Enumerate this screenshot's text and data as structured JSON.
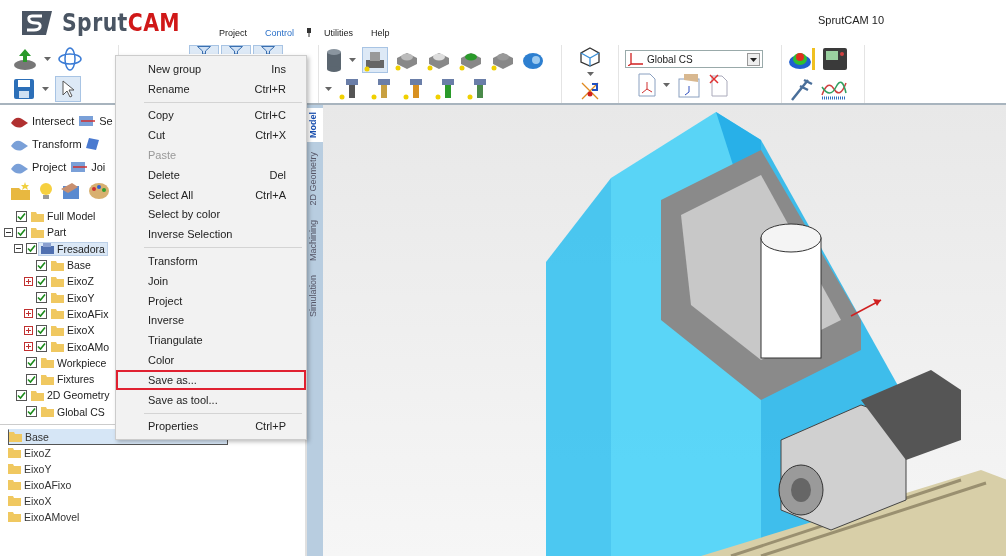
{
  "app": {
    "logo_left": "Sprut",
    "logo_right": "CAM",
    "title": "SprutCAM 10"
  },
  "menu_bar": [
    {
      "label": "Project",
      "selected": false
    },
    {
      "label": "Control",
      "selected": true
    },
    {
      "label": "Utilities",
      "selected": false
    },
    {
      "label": "Help",
      "selected": false
    }
  ],
  "toolbar": {
    "coordinate_system": "Global CS"
  },
  "tool_rows": [
    [
      {
        "label": "Intersect"
      },
      {
        "label": "Se"
      }
    ],
    [
      {
        "label": "Transform"
      }
    ],
    [
      {
        "label": "Project"
      },
      {
        "label": "Joi"
      }
    ]
  ],
  "tree": [
    {
      "label": "Full Model",
      "kind": "folder",
      "expandable": false,
      "checked": true,
      "selected": false
    },
    {
      "label": "Part",
      "kind": "folder",
      "expandable": true,
      "expanded": true,
      "checked": true,
      "selected": false,
      "children": [
        {
          "label": "Fresadora",
          "kind": "model",
          "expandable": true,
          "expanded": true,
          "checked": true,
          "selected": true,
          "children": [
            {
              "label": "Base",
              "kind": "folder",
              "expandable": false,
              "checked": true,
              "selected": false
            },
            {
              "label": "EixoZ",
              "kind": "folder",
              "expandable": true,
              "expanded": false,
              "checked": true,
              "selected": false
            },
            {
              "label": "EixoY",
              "kind": "folder",
              "expandable": false,
              "checked": true,
              "selected": false
            },
            {
              "label": "EixoAFix",
              "kind": "folder",
              "expandable": true,
              "expanded": false,
              "checked": true,
              "selected": false
            },
            {
              "label": "EixoX",
              "kind": "folder",
              "expandable": true,
              "expanded": false,
              "checked": true,
              "selected": false
            },
            {
              "label": "EixoAMo",
              "kind": "folder",
              "expandable": true,
              "expanded": false,
              "checked": true,
              "selected": false
            }
          ]
        },
        {
          "label": "Workpiece",
          "kind": "folder",
          "expandable": false,
          "checked": true,
          "selected": false
        },
        {
          "label": "Fixtures",
          "kind": "folder",
          "expandable": false,
          "checked": true,
          "selected": false
        }
      ]
    },
    {
      "label": "2D Geometry",
      "kind": "folder",
      "expandable": false,
      "checked": true,
      "selected": false,
      "children": [
        {
          "label": "Global CS",
          "kind": "folder",
          "expandable": false,
          "checked": true,
          "selected": false
        }
      ]
    }
  ],
  "parts_list": [
    {
      "label": "Base",
      "selected": true
    },
    {
      "label": "EixoZ",
      "selected": false
    },
    {
      "label": "EixoY",
      "selected": false
    },
    {
      "label": "EixoAFixo",
      "selected": false
    },
    {
      "label": "EixoX",
      "selected": false
    },
    {
      "label": "EixoAMovel",
      "selected": false
    }
  ],
  "side_tabs": [
    {
      "label": "Model",
      "selected": true
    },
    {
      "label": "2D Geometry",
      "selected": false
    },
    {
      "label": "Machining",
      "selected": false
    },
    {
      "label": "Simulation",
      "selected": false
    }
  ],
  "context_menu": [
    [
      {
        "label": "New group",
        "shortcut": "Ins",
        "disabled": false,
        "highlighted": false
      },
      {
        "label": "Rename",
        "shortcut": "Ctrl+R",
        "disabled": false,
        "highlighted": false
      }
    ],
    [
      {
        "label": "Copy",
        "shortcut": "Ctrl+C",
        "disabled": false,
        "highlighted": false
      },
      {
        "label": "Cut",
        "shortcut": "Ctrl+X",
        "disabled": false,
        "highlighted": false
      },
      {
        "label": "Paste",
        "disabled": true,
        "highlighted": false
      },
      {
        "label": "Delete",
        "shortcut": "Del",
        "disabled": false,
        "highlighted": false
      },
      {
        "label": "Select All",
        "shortcut": "Ctrl+A",
        "disabled": false,
        "highlighted": false
      },
      {
        "label": "Select by color",
        "disabled": false,
        "highlighted": false
      },
      {
        "label": "Inverse Selection",
        "disabled": false,
        "highlighted": false
      }
    ],
    [
      {
        "label": "Transform",
        "disabled": false,
        "highlighted": false
      },
      {
        "label": "Join",
        "disabled": false,
        "highlighted": false
      },
      {
        "label": "Project",
        "disabled": false,
        "highlighted": false
      },
      {
        "label": "Inverse",
        "disabled": false,
        "highlighted": false
      },
      {
        "label": "Triangulate",
        "disabled": false,
        "highlighted": false
      },
      {
        "label": "Color",
        "disabled": false,
        "highlighted": false
      },
      {
        "label": "Save as...",
        "disabled": false,
        "highlighted": true
      },
      {
        "label": "Save as tool...",
        "disabled": false,
        "highlighted": false
      }
    ],
    [
      {
        "label": "Properties",
        "shortcut": "Ctrl+P",
        "disabled": false,
        "highlighted": false
      }
    ]
  ]
}
